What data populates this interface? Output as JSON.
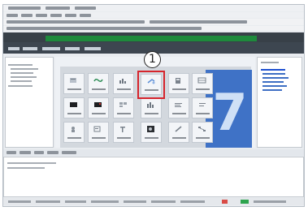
{
  "screen": {
    "callout_number": "1",
    "big_number": "7"
  },
  "tiles": {
    "row1": [
      "document-icon",
      "green-wave-icon",
      "chart-icon",
      "selected-wizard-icon",
      "clipboard-icon",
      "table-icon"
    ],
    "row2": [
      "black-box-icon",
      "red-black-box-icon",
      "grid-icon",
      "chart-bars-icon",
      "bars-icon",
      "lines-icon"
    ],
    "row3": [
      "person-icon",
      "form-icon",
      "text-icon",
      "dark-photo-icon",
      "pen-icon",
      "diagram-icon"
    ]
  },
  "colors": {
    "highlight": "#d6252c",
    "accent_green": "#1e8a3c",
    "blue_panel": "#3f72c6"
  }
}
